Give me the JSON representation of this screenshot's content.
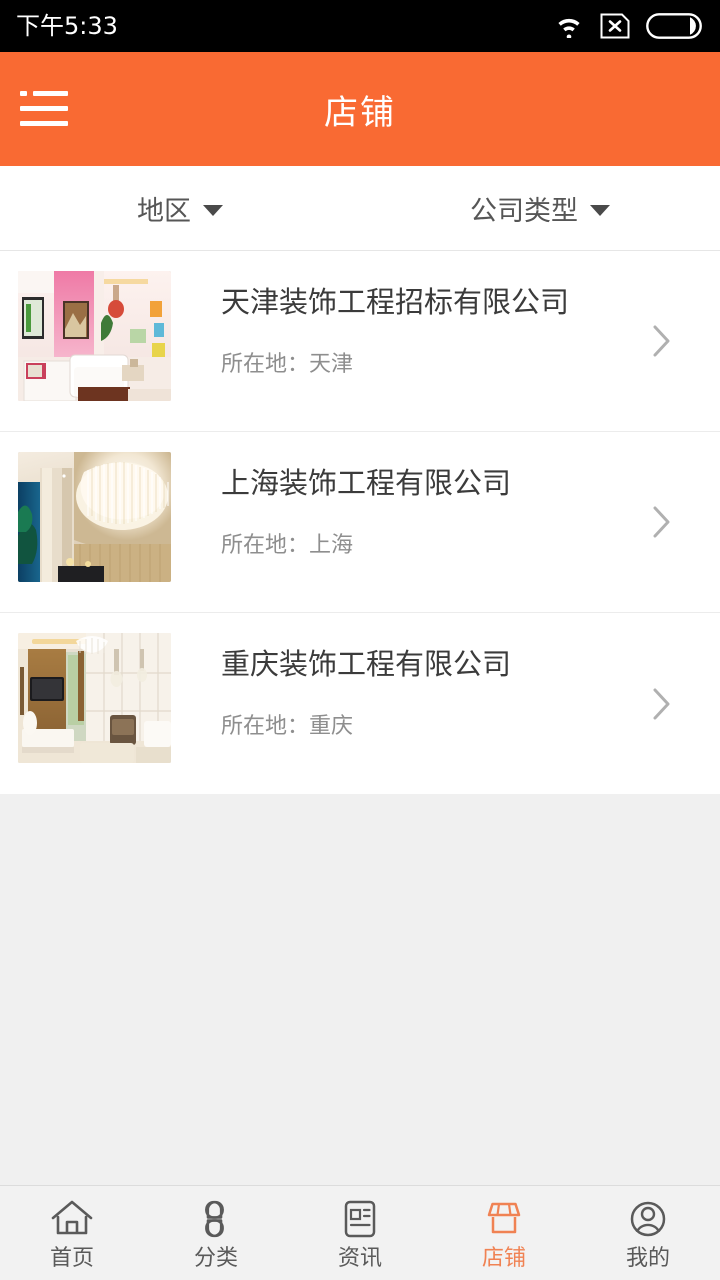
{
  "statusbar": {
    "time": "下午5:33",
    "icons": [
      "wifi-icon",
      "sim-card-disabled-icon",
      "battery-icon"
    ]
  },
  "header": {
    "title": "店铺",
    "menu_icon": "hamburger-menu-icon",
    "background_color": "#f96a33"
  },
  "filters": [
    {
      "label": "地区",
      "icon": "chevron-down-icon"
    },
    {
      "label": "公司类型",
      "icon": "chevron-down-icon"
    }
  ],
  "list": {
    "items": [
      {
        "title": "天津装饰工程招标有限公司",
        "location_label": "所在地：天津",
        "thumbnail": "pink-living-room-photo",
        "chevron": "chevron-right-icon"
      },
      {
        "title": "上海装饰工程有限公司",
        "location_label": "所在地：上海",
        "thumbnail": "crystal-chandelier-lobby-photo",
        "chevron": "chevron-right-icon"
      },
      {
        "title": "重庆装饰工程有限公司",
        "location_label": "所在地：重庆",
        "thumbnail": "modern-living-room-photo",
        "chevron": "chevron-right-icon"
      }
    ]
  },
  "tabbar": {
    "active_color": "#f08253",
    "inactive_color": "#5a5a5a",
    "items": [
      {
        "label": "首页",
        "icon": "home-icon",
        "active": false
      },
      {
        "label": "分类",
        "icon": "category-icon",
        "active": false
      },
      {
        "label": "资讯",
        "icon": "news-icon",
        "active": false
      },
      {
        "label": "店铺",
        "icon": "shop-icon",
        "active": true
      },
      {
        "label": "我的",
        "icon": "profile-icon",
        "active": false
      }
    ]
  }
}
